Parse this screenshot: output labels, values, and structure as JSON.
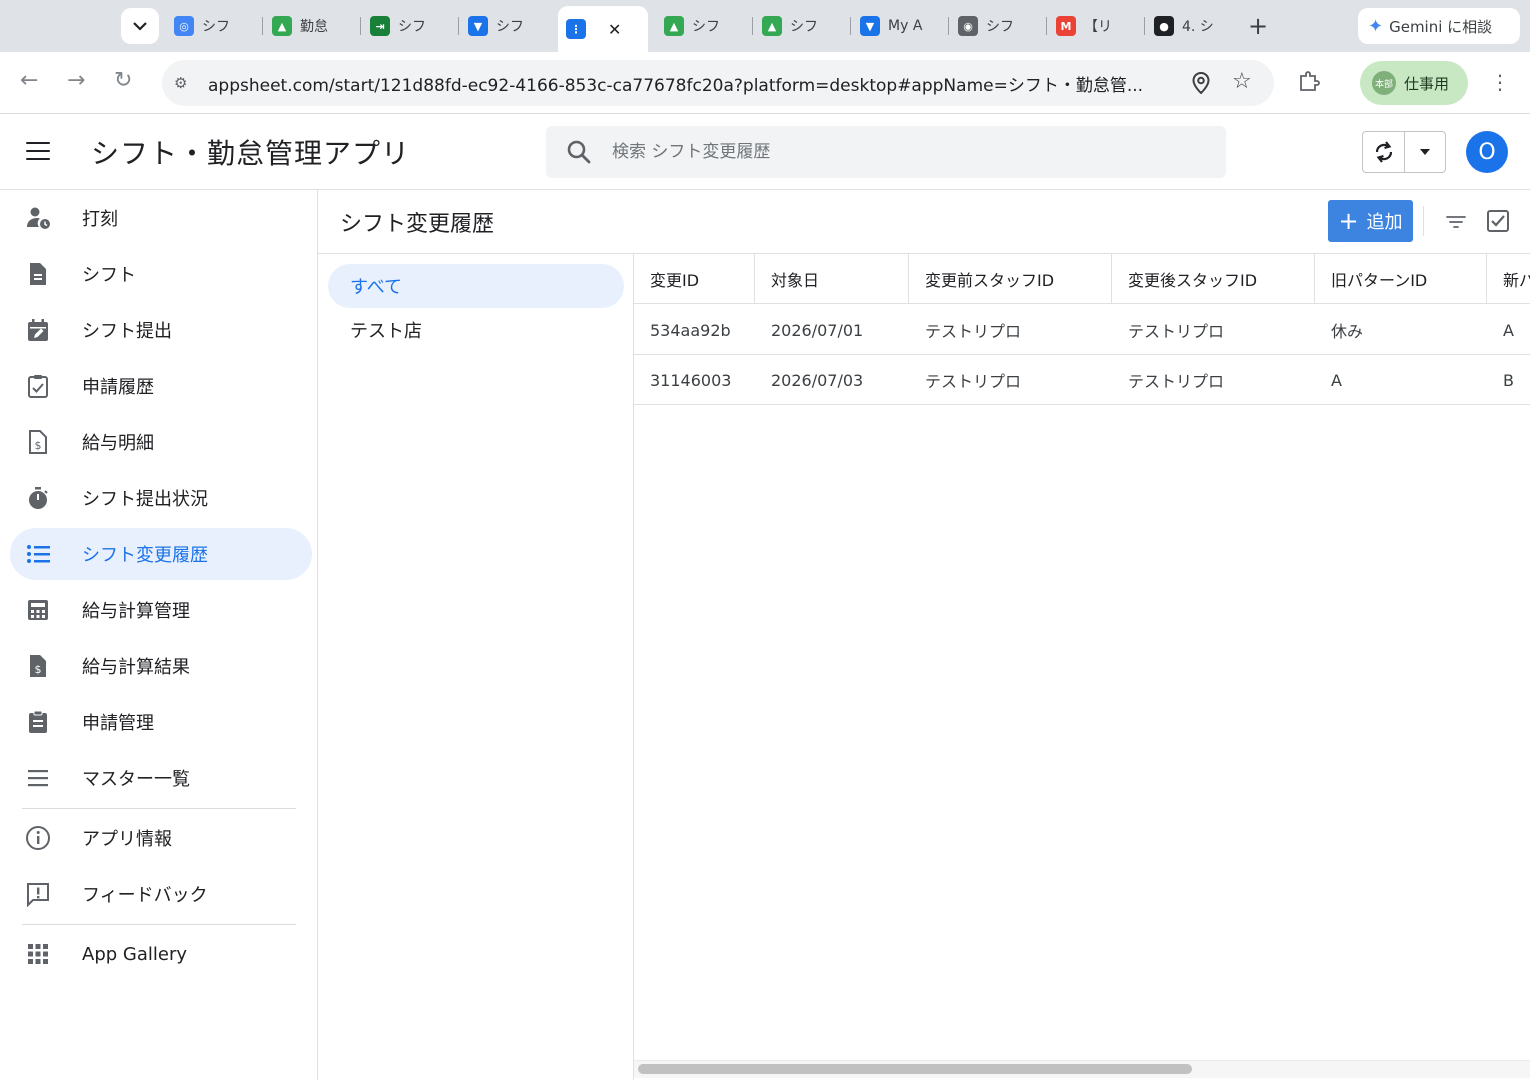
{
  "browser": {
    "tabs": [
      {
        "label": "シフ",
        "color": "#4285f4",
        "glyph": "◎"
      },
      {
        "label": "勤怠",
        "color": "#34a853",
        "glyph": "▲"
      },
      {
        "label": "シフ",
        "color": "#188038",
        "glyph": "⇥"
      },
      {
        "label": "シフ",
        "color": "#1a73e8",
        "glyph": "▼"
      },
      {
        "label": "",
        "color": "#1a73e8",
        "glyph": "⋮",
        "active": true
      },
      {
        "label": "シフ",
        "color": "#34a853",
        "glyph": "▲"
      },
      {
        "label": "シフ",
        "color": "#34a853",
        "glyph": "▲"
      },
      {
        "label": "My A",
        "color": "#1a73e8",
        "glyph": "▼"
      },
      {
        "label": "シフ",
        "color": "#5f6368",
        "glyph": "◉"
      },
      {
        "label": "【リ",
        "color": "#ea4335",
        "glyph": "M"
      },
      {
        "label": "4. シ",
        "color": "#202124",
        "glyph": "●"
      }
    ],
    "gemini_label": "Gemini に相談",
    "url": "appsheet.com/start/121d88fd-ec92-4166-853c-ca77678fc20a?platform=desktop#appName=シフト・勤怠管...",
    "profile_label": "仕事用",
    "profile_badge": "本部"
  },
  "app": {
    "title": "シフト・勤怠管理アプリ",
    "search_placeholder": "検索 シフト変更履歴",
    "avatar_initial": "O",
    "accent": "#1a73e8"
  },
  "sidebar": {
    "items": [
      {
        "label": "打刻",
        "icon": "person-clock-icon"
      },
      {
        "label": "シフト",
        "icon": "document-icon"
      },
      {
        "label": "シフト提出",
        "icon": "calendar-edit-icon"
      },
      {
        "label": "申請履歴",
        "icon": "clipboard-check-icon"
      },
      {
        "label": "給与明細",
        "icon": "payslip-icon"
      },
      {
        "label": "シフト提出状況",
        "icon": "stopwatch-icon"
      },
      {
        "label": "シフト変更履歴",
        "icon": "list-icon",
        "selected": true
      },
      {
        "label": "給与計算管理",
        "icon": "calculator-icon"
      },
      {
        "label": "給与計算結果",
        "icon": "dollar-document-icon"
      },
      {
        "label": "申請管理",
        "icon": "clipboard-list-icon"
      },
      {
        "label": "マスター一覧",
        "icon": "menu-lines-icon"
      }
    ],
    "footer_items": [
      {
        "label": "アプリ情報",
        "icon": "info-icon"
      },
      {
        "label": "フィードバック",
        "icon": "feedback-icon"
      }
    ],
    "gallery_label": "App Gallery"
  },
  "view": {
    "title": "シフト変更履歴",
    "add_label": "追加",
    "groups": [
      "すべて",
      "テスト店"
    ],
    "columns": [
      "変更ID",
      "対象日",
      "変更前スタッフID",
      "変更後スタッフID",
      "旧パターンID",
      "新パ"
    ],
    "rows": [
      [
        "534aa92b",
        "2026/07/01",
        "テストリプロ",
        "テストリプロ",
        "休み",
        "A"
      ],
      [
        "31146003",
        "2026/07/03",
        "テストリプロ",
        "テストリプロ",
        "A",
        "B"
      ]
    ]
  }
}
